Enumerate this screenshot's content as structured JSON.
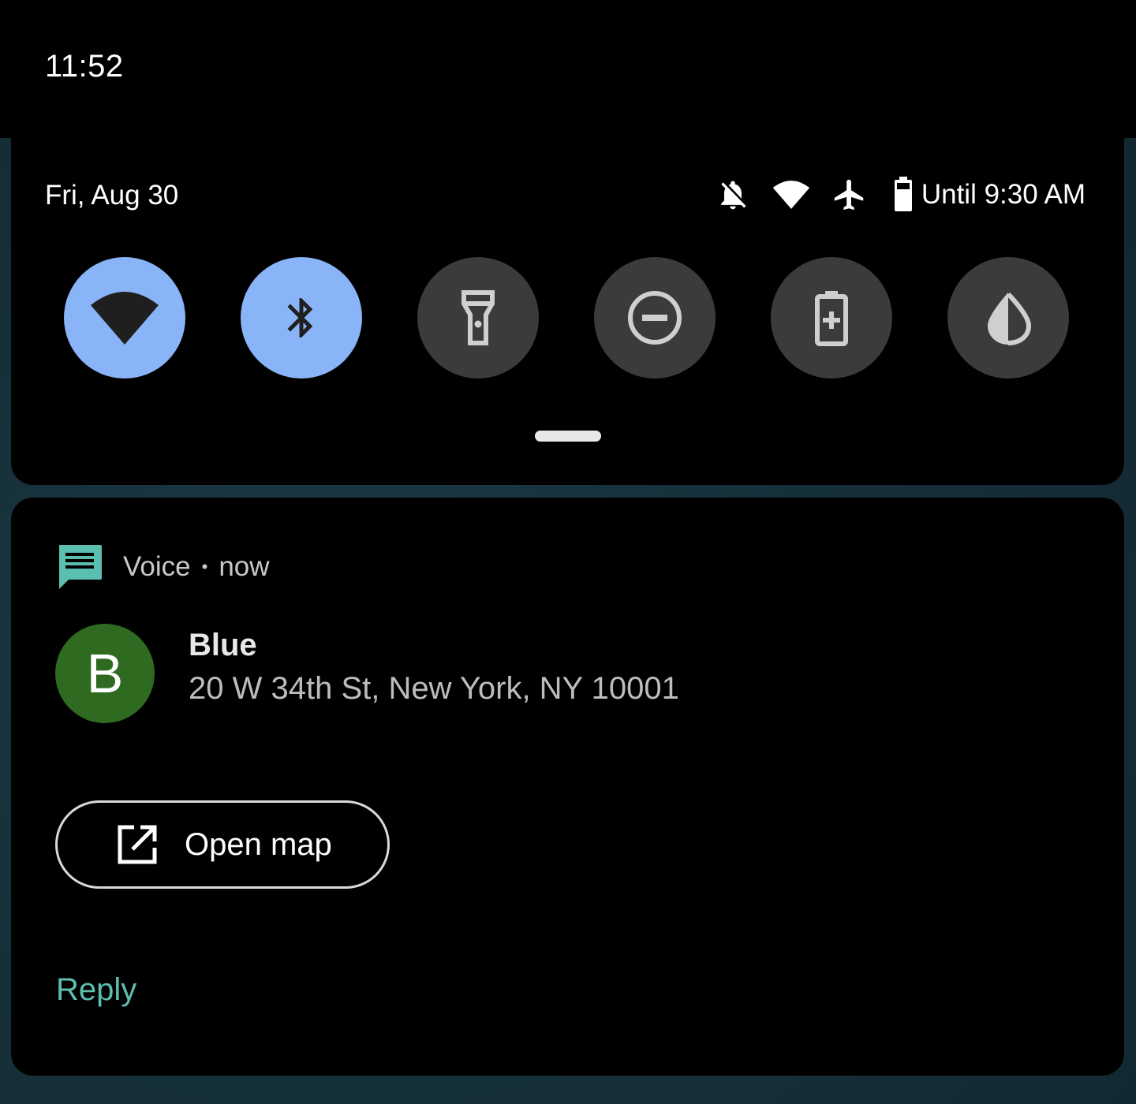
{
  "status_bar": {
    "time": "11:52"
  },
  "quick_settings": {
    "date": "Fri, Aug 30",
    "battery_text": "Until 9:30 AM",
    "status_icons": [
      "notifications-off-icon",
      "wifi-icon",
      "airplane-icon",
      "battery-icon"
    ],
    "tiles": [
      {
        "name": "wifi",
        "icon": "wifi-icon",
        "state": "on"
      },
      {
        "name": "bluetooth",
        "icon": "bluetooth-icon",
        "state": "on"
      },
      {
        "name": "flashlight",
        "icon": "flashlight-icon",
        "state": "off"
      },
      {
        "name": "do-not-disturb",
        "icon": "do-not-disturb-icon",
        "state": "off"
      },
      {
        "name": "battery-saver",
        "icon": "battery-saver-icon",
        "state": "off"
      },
      {
        "name": "invert-colors",
        "icon": "invert-colors-icon",
        "state": "off"
      }
    ],
    "colors": {
      "tile_on": "#8ab4f8",
      "tile_off": "#3b3b3b"
    }
  },
  "notification": {
    "app_name": "Voice",
    "separator": "•",
    "time": "now",
    "avatar_letter": "B",
    "sender": "Blue",
    "message": "20 W 34th St, New York, NY 10001",
    "action_button": "Open map",
    "reply_label": "Reply",
    "colors": {
      "app_icon": "#5bbfb0",
      "avatar_bg": "#2e6a1f",
      "reply": "#5bbfb0"
    }
  }
}
